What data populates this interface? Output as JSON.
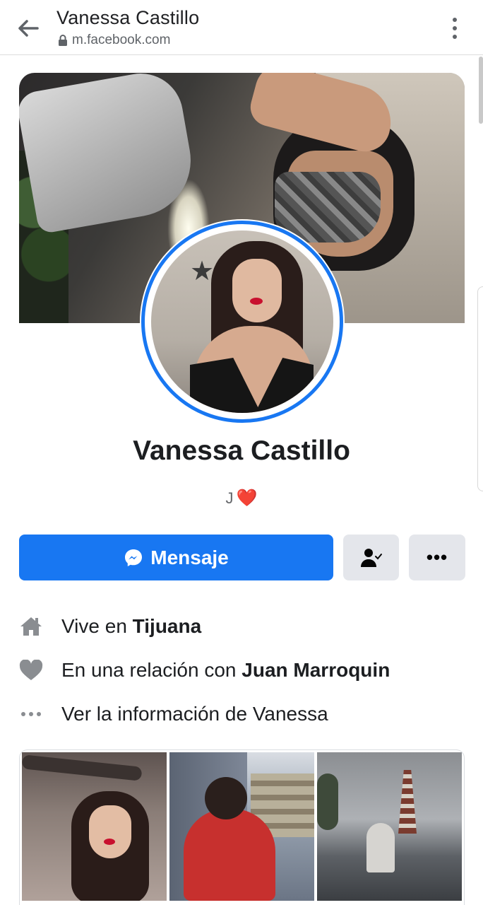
{
  "browser": {
    "title": "Vanessa Castillo",
    "url": "m.facebook.com"
  },
  "profile": {
    "name": "Vanessa Castillo",
    "bio_text": "J",
    "bio_emoji": "❤️"
  },
  "actions": {
    "message_label": "Mensaje",
    "more_label": "•••"
  },
  "info": {
    "lives_prefix": "Vive en ",
    "lives_city": "Tijuana",
    "relationship_prefix": "En una relación con ",
    "relationship_partner": "Juan Marroquin",
    "see_info": "Ver la información de Vanessa"
  },
  "icons": {
    "back": "back-arrow-icon",
    "lock": "lock-icon",
    "menu": "vertical-dots-icon",
    "messenger": "messenger-icon",
    "friend": "friends-check-icon",
    "home": "home-icon",
    "heart": "heart-icon",
    "dots": "horizontal-dots-icon"
  },
  "colors": {
    "accent": "#1877f2",
    "secondary_button": "#e4e6eb",
    "icon_gray": "#8a8d91"
  }
}
